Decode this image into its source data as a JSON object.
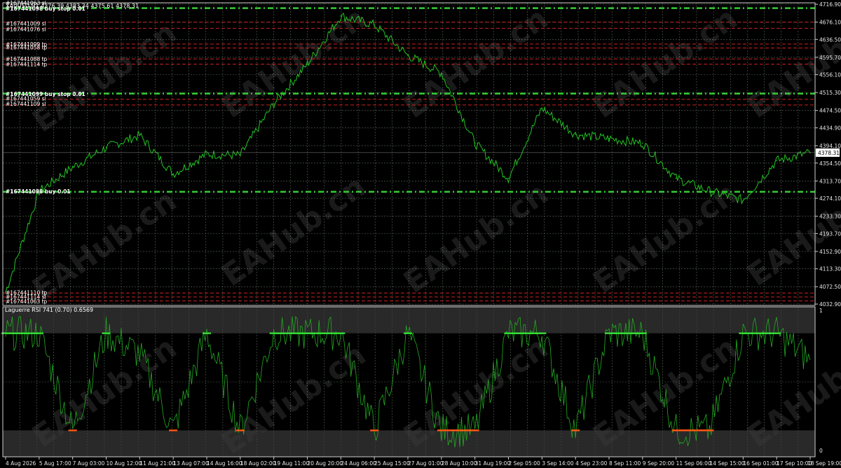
{
  "header": {
    "symbol_line": "XAUUSD,H1  4376.39 4383.34 4375.61 4378.31",
    "top_id": "#167441063 sl"
  },
  "price_panel": {
    "last_price": "4378.31",
    "y_ticks": [
      "4716.90",
      "4676.10",
      "4636.50",
      "4595.70",
      "4556.10",
      "4515.30",
      "4474.50",
      "4434.90",
      "4394.10",
      "4354.50",
      "4313.70",
      "4274.10",
      "4233.30",
      "4193.70",
      "4152.90",
      "4113.30",
      "4072.50",
      "4032.90"
    ],
    "order_labels": [
      {
        "text": "#167441098 buy stop 0.01",
        "bold": true,
        "price": 4707
      },
      {
        "text": "#167441009 sl",
        "bold": false,
        "price": 4673
      },
      {
        "text": "#167441076 sl",
        "bold": false,
        "price": 4660
      },
      {
        "text": "#167441099 tp",
        "bold": false,
        "price": 4626
      },
      {
        "text": "#167441058 tp",
        "bold": false,
        "price": 4619
      },
      {
        "text": "#167441088 tp",
        "bold": false,
        "price": 4592
      },
      {
        "text": "#167441114 tp",
        "bold": false,
        "price": 4580
      },
      {
        "text": "#167441099 buy stop 0.01",
        "bold": true,
        "price": 4512
      },
      {
        "text": "#167441059 sl",
        "bold": false,
        "price": 4502
      },
      {
        "text": "#167441109 sl",
        "bold": false,
        "price": 4490
      },
      {
        "text": "#167441088 buy 0.01",
        "bold": true,
        "price": 4290
      },
      {
        "text": "#167441110 tp",
        "bold": false,
        "price": 4059
      },
      {
        "text": "#167441114 sl",
        "bold": false,
        "price": 4050
      },
      {
        "text": "#167441063 tp",
        "bold": false,
        "price": 4039
      }
    ],
    "green_levels": [
      4708,
      4513,
      4289
    ],
    "red_levels": [
      4676,
      4662,
      4626,
      4617,
      4592,
      4580,
      4500,
      4487,
      4058,
      4049,
      4040
    ]
  },
  "indicator_panel": {
    "title": "Laguerre RSI 741 (0.70) 0.6569",
    "y_ticks": [
      "1",
      "0"
    ],
    "upper_level": 0.85,
    "lower_level": 0.15
  },
  "x_axis": {
    "labels": [
      "4 Aug 2026",
      "5 Aug 17:00",
      "7 Aug 03:00",
      "10 Aug 12:00",
      "11 Aug 21:00",
      "13 Aug 07:00",
      "14 Aug 16:00",
      "18 Aug 02:00",
      "19 Aug 11:00",
      "20 Aug 20:00",
      "24 Aug 06:00",
      "25 Aug 15:00",
      "27 Aug 01:00",
      "28 Aug 10:00",
      "31 Aug 19:00",
      "2 Sep 05:00",
      "3 Sep 14:00",
      "4 Sep 23:00",
      "8 Sep 11:00",
      "9 Sep 20:00",
      "11 Sep 06:00",
      "14 Sep 15:00",
      "16 Sep 01:00",
      "17 Sep 10:00",
      "18 Sep 19:00"
    ]
  },
  "watermark": {
    "text": "EAHub.cn"
  },
  "colors": {
    "price_line": "#22c322",
    "rsi_line": "#22aa22",
    "grid": "#5a6a5a",
    "green_level": "#33cc33",
    "red_level": "#cc2222",
    "rsi_high": "#33dd33",
    "rsi_low": "#ff5511"
  },
  "chart_data": [
    {
      "type": "line",
      "title": "XAUUSD,H1",
      "ylim": [
        4032.9,
        4716.9
      ],
      "x": [
        "4 Aug 2026",
        "5 Aug 17:00",
        "7 Aug 03:00",
        "10 Aug 12:00",
        "11 Aug 21:00",
        "13 Aug 07:00",
        "14 Aug 16:00",
        "18 Aug 02:00",
        "19 Aug 11:00",
        "20 Aug 20:00",
        "24 Aug 06:00",
        "25 Aug 15:00",
        "27 Aug 01:00",
        "28 Aug 10:00",
        "31 Aug 19:00",
        "2 Sep 05:00",
        "3 Sep 14:00",
        "4 Sep 23:00",
        "8 Sep 11:00",
        "9 Sep 20:00",
        "11 Sep 06:00",
        "14 Sep 15:00",
        "16 Sep 01:00",
        "17 Sep 10:00",
        "18 Sep 19:00"
      ],
      "series": [
        {
          "values": [
            4060,
            4290,
            4345,
            4390,
            4418,
            4330,
            4375,
            4372,
            4490,
            4580,
            4690,
            4670,
            4600,
            4560,
            4400,
            4320,
            4480,
            4420,
            4410,
            4400,
            4320,
            4290,
            4270,
            4360,
            4378
          ]
        }
      ]
    },
    {
      "type": "line",
      "title": "Laguerre RSI 741 (0.70) 0.6569",
      "ylim": [
        0,
        1
      ],
      "x": [
        "4 Aug 2026",
        "5 Aug 17:00",
        "7 Aug 03:00",
        "10 Aug 12:00",
        "11 Aug 21:00",
        "13 Aug 07:00",
        "14 Aug 16:00",
        "18 Aug 02:00",
        "19 Aug 11:00",
        "20 Aug 20:00",
        "24 Aug 06:00",
        "25 Aug 15:00",
        "27 Aug 01:00",
        "28 Aug 10:00",
        "31 Aug 19:00",
        "2 Sep 05:00",
        "3 Sep 14:00",
        "4 Sep 23:00",
        "8 Sep 11:00",
        "9 Sep 20:00",
        "11 Sep 06:00",
        "14 Sep 15:00",
        "16 Sep 01:00",
        "17 Sep 10:00",
        "18 Sep 19:00"
      ],
      "series": [
        {
          "values": [
            0.85,
            0.85,
            0.15,
            0.85,
            0.7,
            0.15,
            0.85,
            0.15,
            0.85,
            0.85,
            0.85,
            0.15,
            0.85,
            0.15,
            0.15,
            0.85,
            0.85,
            0.15,
            0.85,
            0.85,
            0.15,
            0.15,
            0.85,
            0.85,
            0.6569
          ]
        }
      ]
    }
  ]
}
